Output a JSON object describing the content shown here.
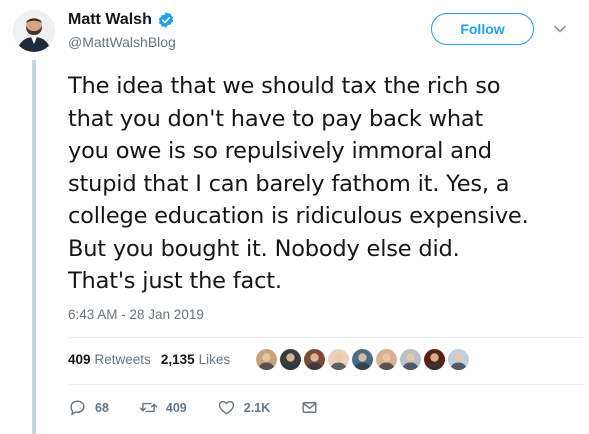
{
  "author": {
    "display_name": "Matt Walsh",
    "handle": "@MattWalshBlog",
    "verified_icon": "verified-badge-icon"
  },
  "header": {
    "follow_label": "Follow",
    "menu_icon": "chevron-down-icon"
  },
  "tweet": {
    "lines": [
      "The idea that we should tax the rich so",
      "that you don't have to pay back what",
      "you owe is so repulsively immoral and",
      "stupid that I can barely fathom it. Yes, a",
      "college education is ridiculous expensive.",
      "But you bought it. Nobody else did.",
      "That's just the fact."
    ],
    "timestamp": "6:43 AM - 28 Jan 2019"
  },
  "stats": {
    "retweets_count": "409",
    "retweets_label": "Retweets",
    "likes_count": "2,135",
    "likes_label": "Likes",
    "liker_avatar_colors": [
      "#c8a27c",
      "#3a3a3a",
      "#7a4a3a",
      "#e8d2c0",
      "#4a6a8a",
      "#d8b090",
      "#b8c0c8",
      "#5a2010",
      "#c0d0e0"
    ]
  },
  "actions": {
    "reply_count": "68",
    "retweet_count": "409",
    "like_count": "2.1K",
    "icons": [
      "reply-icon",
      "retweet-icon",
      "heart-icon",
      "envelope-icon"
    ]
  },
  "colors": {
    "accent": "#1da1f2",
    "secondary_text": "#657786",
    "primary_text": "#14171a",
    "divider": "#e6ecf0",
    "thread_line": "#ccd6dd"
  }
}
